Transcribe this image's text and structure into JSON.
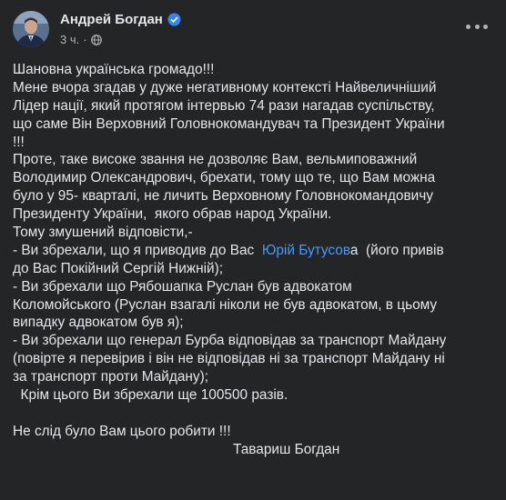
{
  "post": {
    "author": "Андрей Богдан",
    "time": "3 ч.",
    "time_separator": "·",
    "colors": {
      "background": "#242526",
      "text": "#e4e6eb",
      "secondary": "#b0b3b8",
      "link": "#4599ff",
      "verified": "#2d88ff"
    },
    "icons": {
      "verified": "verified-badge-icon",
      "privacy": "globe-icon",
      "menu": "more-options-icon"
    },
    "body": {
      "l1": "Шановна українська громадо!!!",
      "l2": "Мене вчора згадав у дуже негативному контексті Найвеличніший",
      "l3": "Лідер нації, який протягом інтервью 74 рази нагадав суспільству,",
      "l4": "що саме Він Верховний Головнокомандувач та Президент України",
      "l5": "!!!",
      "l6": "Проте, таке високе звання не дозволяє Вам, вельмиповажний",
      "l7": "Володимир Олександрович, брехати, тому що те, що Вам можна",
      "l8": "було у 95- кварталі, не личить Верховному Головнокомандовичу",
      "l9": "Президенту України,  якого обрав народ України.",
      "l10": "Тому змушений відповісти,-",
      "l11_pre": "- Ви збрехали, що я приводив до Вас  ",
      "l11_link": "Юрій Бутусов",
      "l11_post": "а  (його привів",
      "l12": "до Вас Покійний Сергій Нижній);",
      "l13": "- Ви збрехали що Рябошапка Руслан був адвокатом",
      "l14": "Коломойського (Руслан взагалі ніколи не був адвокатом, в цьому",
      "l15": "випадку адвокатом був я);",
      "l16": "- Ви збрехали що генерал Бурба відповідав за транспорт Майдану",
      "l17": "(повірте я перевірив і він не відповідав ні за транспорт Майдану ні",
      "l18": "за транспорт проти Майдану);",
      "l19": "  Крім цього Ви збрехали ще 100500 разів.",
      "l20": "Не слід було Вам цього робити !!!",
      "l21": "Тавариш Богдан"
    }
  }
}
